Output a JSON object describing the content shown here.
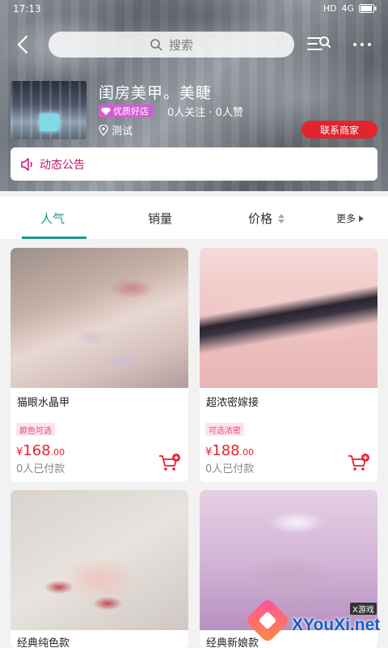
{
  "status_bar": {
    "time": "17:13",
    "signal_labels": [
      "HD",
      "4G"
    ]
  },
  "header": {
    "search_placeholder": "搜索"
  },
  "store": {
    "name": "闺房美甲。美睫",
    "badge": "优质好店",
    "stats": "0人关注 · 0人赞",
    "location": "测试",
    "contact_button": "联系商家"
  },
  "notice": {
    "label": "动态公告"
  },
  "tabs": {
    "popular": "人气",
    "sales": "销量",
    "price": "价格",
    "more": "更多"
  },
  "products": [
    {
      "title": "猫眼水晶甲",
      "tag": "颜色可选",
      "currency": "¥",
      "price_int": "168",
      "price_dec": ".00",
      "sold": "0人已付款"
    },
    {
      "title": "超浓密嫁接",
      "tag": "可选浓密",
      "currency": "¥",
      "price_int": "188",
      "price_dec": ".00",
      "sold": "0人已付款"
    },
    {
      "title": "经典纯色款"
    },
    {
      "title": "经典新娘款"
    }
  ],
  "watermark": {
    "brand": "XYouXi.net",
    "sub": "X游戏"
  },
  "colors": {
    "accent": "#1b9a8e",
    "price": "#e3232e",
    "notice": "#c0156e",
    "badge": "#d65bd6"
  }
}
